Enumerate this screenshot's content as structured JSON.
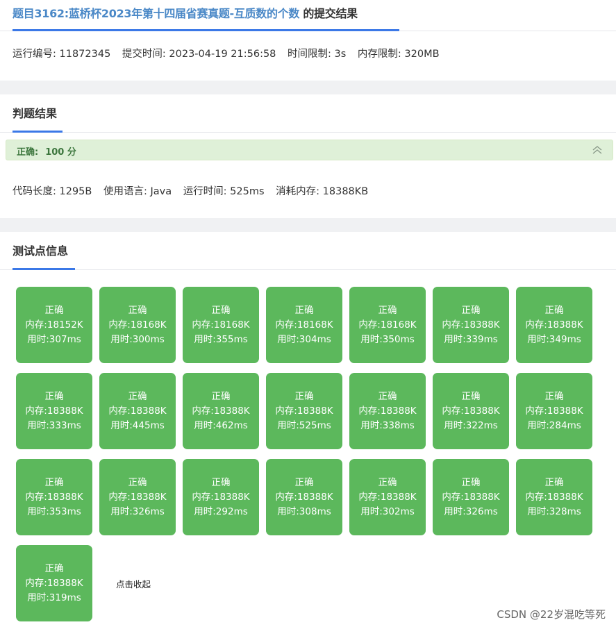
{
  "header": {
    "problem_link": "题目3162:蓝桥杯2023年第十四届省赛真题-互质数的个数",
    "suffix": " 的提交结果"
  },
  "submission": {
    "run_id": "运行编号: 11872345",
    "submit_time": "提交时间: 2023-04-19 21:56:58",
    "time_limit": "时间限制: 3s",
    "memory_limit": "内存限制: 320MB"
  },
  "judge": {
    "section_title": "判题结果",
    "status_label": "正确:",
    "score": "100 分",
    "code_length": "代码长度: 1295B",
    "language": "使用语言: Java",
    "run_time": "运行时间: 525ms",
    "memory_used": "消耗内存: 18388KB"
  },
  "tests": {
    "section_title": "测试点信息",
    "toggle_label": "点击收起",
    "items": [
      {
        "status": "正确",
        "memory": "内存:18152K",
        "time": "用时:307ms"
      },
      {
        "status": "正确",
        "memory": "内存:18168K",
        "time": "用时:300ms"
      },
      {
        "status": "正确",
        "memory": "内存:18168K",
        "time": "用时:355ms"
      },
      {
        "status": "正确",
        "memory": "内存:18168K",
        "time": "用时:304ms"
      },
      {
        "status": "正确",
        "memory": "内存:18168K",
        "time": "用时:350ms"
      },
      {
        "status": "正确",
        "memory": "内存:18388K",
        "time": "用时:339ms"
      },
      {
        "status": "正确",
        "memory": "内存:18388K",
        "time": "用时:349ms"
      },
      {
        "status": "正确",
        "memory": "内存:18388K",
        "time": "用时:333ms"
      },
      {
        "status": "正确",
        "memory": "内存:18388K",
        "time": "用时:445ms"
      },
      {
        "status": "正确",
        "memory": "内存:18388K",
        "time": "用时:462ms"
      },
      {
        "status": "正确",
        "memory": "内存:18388K",
        "time": "用时:525ms"
      },
      {
        "status": "正确",
        "memory": "内存:18388K",
        "time": "用时:338ms"
      },
      {
        "status": "正确",
        "memory": "内存:18388K",
        "time": "用时:322ms"
      },
      {
        "status": "正确",
        "memory": "内存:18388K",
        "time": "用时:284ms"
      },
      {
        "status": "正确",
        "memory": "内存:18388K",
        "time": "用时:353ms"
      },
      {
        "status": "正确",
        "memory": "内存:18388K",
        "time": "用时:326ms"
      },
      {
        "status": "正确",
        "memory": "内存:18388K",
        "time": "用时:292ms"
      },
      {
        "status": "正确",
        "memory": "内存:18388K",
        "time": "用时:308ms"
      },
      {
        "status": "正确",
        "memory": "内存:18388K",
        "time": "用时:302ms"
      },
      {
        "status": "正确",
        "memory": "内存:18388K",
        "time": "用时:326ms"
      },
      {
        "status": "正确",
        "memory": "内存:18388K",
        "time": "用时:328ms"
      },
      {
        "status": "正确",
        "memory": "内存:18388K",
        "time": "用时:319ms"
      }
    ]
  },
  "watermark": "CSDN @22岁混吃等死",
  "colors": {
    "accent": "#3b78e7",
    "link": "#4a88c7",
    "success_bg": "#dff0d8",
    "success_text": "#3c763d",
    "test_pass": "#5cb85c"
  },
  "icons": {
    "collapse": "double-chevron-up-icon"
  }
}
